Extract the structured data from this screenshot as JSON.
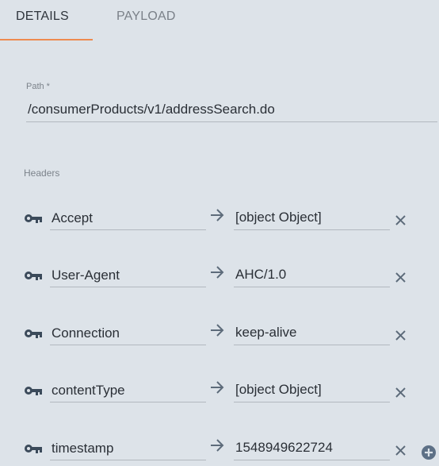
{
  "tabs": {
    "details": "DETAILS",
    "payload": "PAYLOAD",
    "active": "DETAILS"
  },
  "colors": {
    "background": "#dde3e9",
    "accent": "#ee8a4f",
    "icon": "#3b4a5a"
  },
  "path": {
    "label": "Path *",
    "value": "/consumerProducts/v1/addressSearch.do"
  },
  "headers": {
    "label": "Headers",
    "rows": [
      {
        "key": "Accept",
        "value": "[object Object]"
      },
      {
        "key": "User-Agent",
        "value": "AHC/1.0"
      },
      {
        "key": "Connection",
        "value": "keep-alive"
      },
      {
        "key": "contentType",
        "value": "[object Object]"
      },
      {
        "key": "timestamp",
        "value": "1548949622724"
      }
    ]
  },
  "icons": {
    "key": "key-icon",
    "arrow": "arrow-right-icon",
    "remove": "close-icon",
    "add": "add-circle-icon"
  }
}
